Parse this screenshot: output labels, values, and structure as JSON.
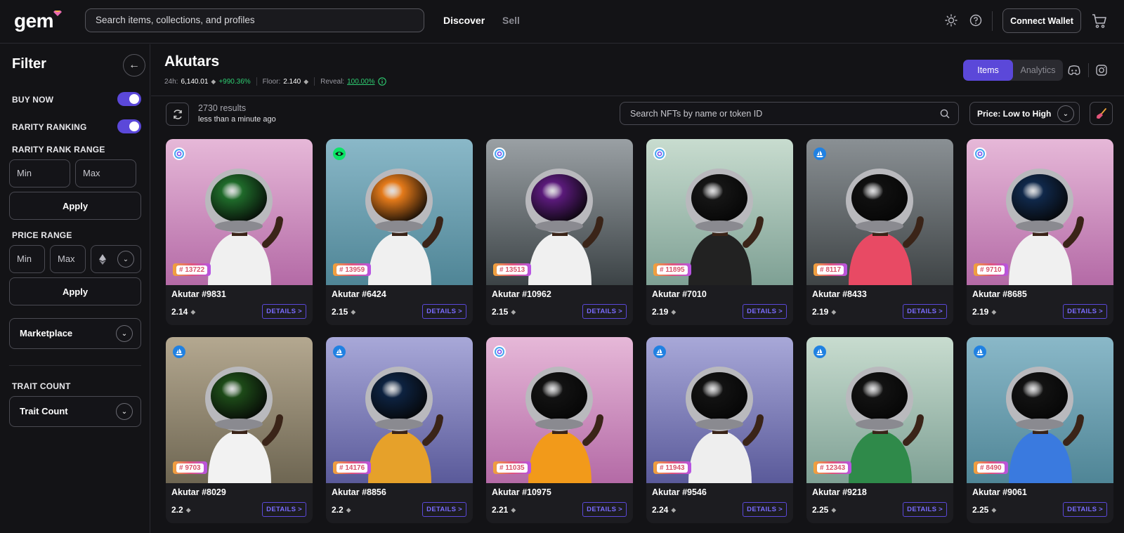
{
  "header": {
    "logo": "gem",
    "search_placeholder": "Search items, collections, and profiles",
    "nav": {
      "discover": "Discover",
      "sell": "Sell"
    },
    "connect_wallet": "Connect Wallet"
  },
  "sidebar": {
    "title": "Filter",
    "buy_now": "BUY NOW",
    "rarity_ranking": "RARITY RANKING",
    "rarity_rank_range": "RARITY RANK RANGE",
    "min": "Min",
    "max": "Max",
    "apply": "Apply",
    "price_range": "PRICE RANGE",
    "marketplace": "Marketplace",
    "trait_count_label": "TRAIT COUNT",
    "trait_count_select": "Trait Count"
  },
  "collection": {
    "name": "Akutars",
    "stats": {
      "vol_label": "24h:",
      "vol_value": "6,140.01",
      "change": "+990.36%",
      "floor_label": "Floor:",
      "floor_value": "2.140",
      "reveal_label": "Reveal:",
      "reveal_value": "100.00%"
    },
    "tabs": {
      "items": "Items",
      "analytics": "Analytics"
    }
  },
  "toolbar": {
    "results": "2730 results",
    "updated": "less than a minute ago",
    "search_placeholder": "Search NFTs by name or token ID",
    "sort": "Price: Low to High"
  },
  "details_label": "DETAILS >",
  "colors": {
    "accent": "#5b48d9",
    "positive": "#2ecc71",
    "opensea": "#2081e2",
    "looksrare": "#0ce466",
    "x2y2": "#4aa7f0"
  },
  "cards": [
    {
      "name": "Akutar #9831",
      "price": "2.14",
      "rank": "# 13722",
      "market": "x2y2",
      "bg": [
        "#e6b8d8",
        "#b46aa6"
      ],
      "helmet": "#1f6a2a",
      "shirt": "#f0f0f0"
    },
    {
      "name": "Akutar #6424",
      "price": "2.15",
      "rank": "# 13959",
      "market": "looksrare",
      "bg": [
        "#8ab8c8",
        "#4f8596"
      ],
      "helmet": "#e47a1a",
      "shirt": "#f0f0f0"
    },
    {
      "name": "Akutar #10962",
      "price": "2.15",
      "rank": "# 13513",
      "market": "x2y2",
      "bg": [
        "#9aa0a4",
        "#3c4346"
      ],
      "helmet": "#5a1a7a",
      "shirt": "#f0f0f0"
    },
    {
      "name": "Akutar #7010",
      "price": "2.19",
      "rank": "# 11895",
      "market": "x2y2",
      "bg": [
        "#c8dccf",
        "#7ea094"
      ],
      "helmet": "#151515",
      "shirt": "#222222"
    },
    {
      "name": "Akutar #8433",
      "price": "2.19",
      "rank": "# 8117",
      "market": "opensea",
      "bg": [
        "#8a9094",
        "#3f4446"
      ],
      "helmet": "#101010",
      "shirt": "#e84a64"
    },
    {
      "name": "Akutar #8685",
      "price": "2.19",
      "rank": "# 9710",
      "market": "x2y2",
      "bg": [
        "#e6b8d8",
        "#b46aa6"
      ],
      "helmet": "#10284a",
      "shirt": "#f0f0f0"
    },
    {
      "name": "Akutar #8029",
      "price": "2.2",
      "rank": "# 9703",
      "market": "opensea",
      "bg": [
        "#b4a890",
        "#6e6652"
      ],
      "helmet": "#1d4a18",
      "shirt": "#f2f2f2"
    },
    {
      "name": "Akutar #8856",
      "price": "2.2",
      "rank": "# 14176",
      "market": "opensea",
      "bg": [
        "#a8a8d8",
        "#5a5a9a"
      ],
      "helmet": "#0d2240",
      "shirt": "#e6a12a"
    },
    {
      "name": "Akutar #10975",
      "price": "2.21",
      "rank": "# 11035",
      "market": "x2y2",
      "bg": [
        "#e6b8d8",
        "#b46aa6"
      ],
      "helmet": "#121212",
      "shirt": "#f29a1a"
    },
    {
      "name": "Akutar #9546",
      "price": "2.24",
      "rank": "# 11943",
      "market": "opensea",
      "bg": [
        "#a8a8d8",
        "#5a5a9a"
      ],
      "helmet": "#121212",
      "shirt": "#eeeeee"
    },
    {
      "name": "Akutar #9218",
      "price": "2.25",
      "rank": "# 12343",
      "market": "opensea",
      "bg": [
        "#c8dccf",
        "#7ea094"
      ],
      "helmet": "#121212",
      "shirt": "#2f8a4a"
    },
    {
      "name": "Akutar #9061",
      "price": "2.25",
      "rank": "# 8490",
      "market": "opensea",
      "bg": [
        "#8ab8c8",
        "#4f8596"
      ],
      "helmet": "#121212",
      "shirt": "#3a7adf"
    }
  ]
}
